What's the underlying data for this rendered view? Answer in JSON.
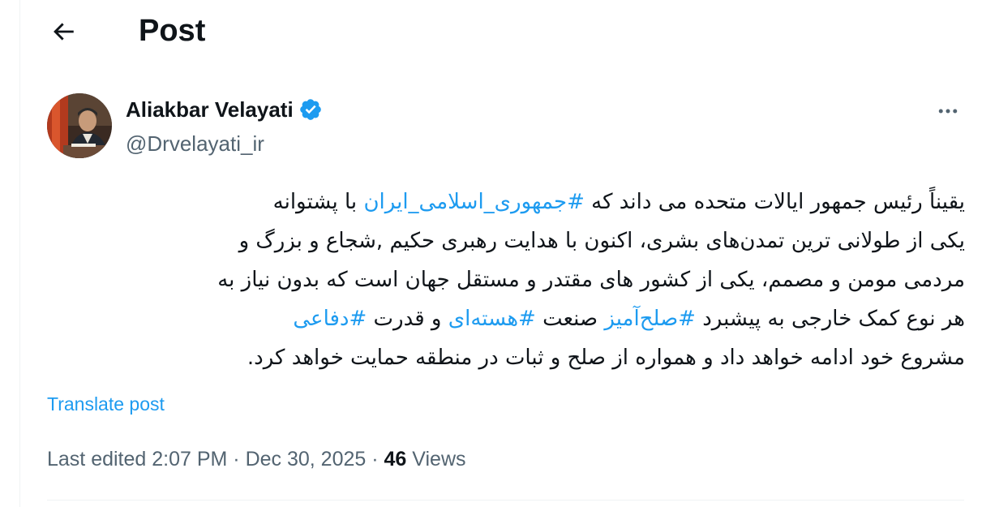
{
  "header": {
    "title": "Post"
  },
  "author": {
    "name": "Aliakbar Velayati",
    "handle": "@Drvelayati_ir",
    "verified": true
  },
  "post": {
    "lines": [
      [
        {
          "text": "یقیناً رئیس جمهور ایالات متحده می داند که ",
          "tag": false
        },
        {
          "text": "#جمهوری_اسلامی_ایران",
          "tag": true
        },
        {
          "text": " با پشتوانه",
          "tag": false
        }
      ],
      [
        {
          "text": "یکی از طولانی ترین تمدن‌های بشری، اکنون با هدایت رهبری حکیم ,شجاع و بزرگ و",
          "tag": false
        }
      ],
      [
        {
          "text": "مردمی مومن و مصمم، یکی از کشور های مقتدر و مستقل جهان است که بدون نیاز به",
          "tag": false
        }
      ],
      [
        {
          "text": "هر نوع کمک خارجی به پیشبرد ",
          "tag": false
        },
        {
          "text": "#صلح‌آمیز",
          "tag": true
        },
        {
          "text": " صنعت ",
          "tag": false
        },
        {
          "text": "#هسته‌ای",
          "tag": true
        },
        {
          "text": " و قدرت ",
          "tag": false
        },
        {
          "text": "#دفاعی",
          "tag": true
        }
      ],
      [
        {
          "text": "مشروع خود ادامه خواهد داد و همواره از صلح و ثبات در منطقه حمایت خواهد کرد.",
          "tag": false
        }
      ]
    ],
    "translate_label": "Translate post"
  },
  "meta": {
    "edited_prefix": "Last edited 2:07 PM · Dec 30, 2025 · ",
    "views_count": "46",
    "views_label": " Views"
  },
  "colors": {
    "accent": "#1d9bf0",
    "text": "#0f1419",
    "secondary": "#536471"
  },
  "icons": {
    "back": "arrow-left-icon",
    "verified": "verified-badge-icon",
    "more": "more-horizontal-icon"
  }
}
